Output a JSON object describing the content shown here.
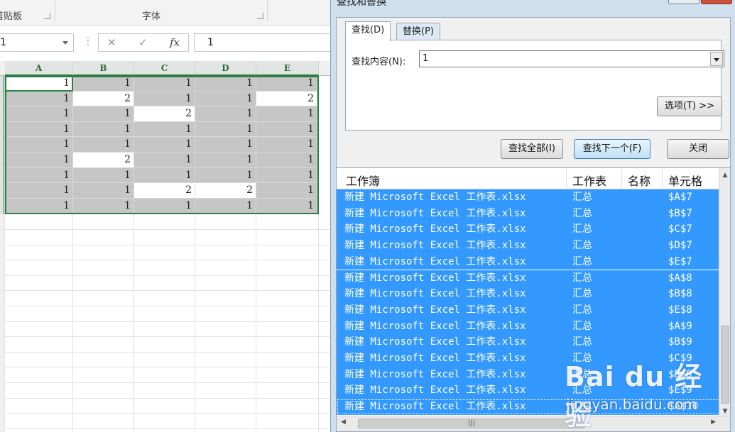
{
  "ribbon": {
    "clipboard_label": "剪贴板",
    "font_label": "字体"
  },
  "formula_bar": {
    "name_box_value": "1",
    "more_icon": "⋮",
    "cancel_icon": "✕",
    "enter_icon": "✓",
    "fx_label": "fx",
    "formula_value": "1"
  },
  "sheet": {
    "columns": [
      "A",
      "B",
      "C",
      "D",
      "E"
    ],
    "rows": [
      [
        1,
        1,
        1,
        1,
        1
      ],
      [
        1,
        2,
        1,
        1,
        2
      ],
      [
        1,
        1,
        2,
        1,
        1
      ],
      [
        1,
        1,
        1,
        1,
        1
      ],
      [
        1,
        1,
        1,
        1,
        1
      ],
      [
        1,
        2,
        1,
        1,
        1
      ],
      [
        1,
        1,
        1,
        1,
        1
      ],
      [
        1,
        1,
        2,
        2,
        1
      ],
      [
        1,
        1,
        1,
        1,
        1
      ]
    ],
    "found": [
      [
        0,
        1,
        1,
        1,
        1
      ],
      [
        1,
        0,
        1,
        1,
        0
      ],
      [
        1,
        1,
        0,
        1,
        1
      ],
      [
        1,
        1,
        1,
        1,
        1
      ],
      [
        1,
        1,
        1,
        1,
        1
      ],
      [
        1,
        0,
        1,
        1,
        1
      ],
      [
        1,
        1,
        1,
        1,
        1
      ],
      [
        1,
        1,
        0,
        0,
        1
      ],
      [
        1,
        1,
        1,
        1,
        1
      ]
    ],
    "highlight_color": "#c6c6c6",
    "selection_color": "#2e7d46"
  },
  "dialog": {
    "title": "查找和替换",
    "tabs": {
      "find": "查找(D)",
      "replace": "替换(P)"
    },
    "find_label": "查找内容(N):",
    "find_value": "1",
    "options_button": "选项(T) >>",
    "find_all_button": "查找全部(I)",
    "find_next_button": "查找下一个(F)",
    "close_button": "关闭",
    "results_headers": {
      "workbook": "工作簿",
      "sheet": "工作表",
      "name": "名称",
      "cell": "单元格"
    },
    "results": [
      {
        "workbook": "新建 Microsoft Excel 工作表.xlsx",
        "sheet": "汇总",
        "cell": "$A$7"
      },
      {
        "workbook": "新建 Microsoft Excel 工作表.xlsx",
        "sheet": "汇总",
        "cell": "$B$7"
      },
      {
        "workbook": "新建 Microsoft Excel 工作表.xlsx",
        "sheet": "汇总",
        "cell": "$C$7"
      },
      {
        "workbook": "新建 Microsoft Excel 工作表.xlsx",
        "sheet": "汇总",
        "cell": "$D$7"
      },
      {
        "workbook": "新建 Microsoft Excel 工作表.xlsx",
        "sheet": "汇总",
        "cell": "$E$7"
      },
      {
        "workbook": "新建 Microsoft Excel 工作表.xlsx",
        "sheet": "汇总",
        "cell": "$A$8"
      },
      {
        "workbook": "新建 Microsoft Excel 工作表.xlsx",
        "sheet": "汇总",
        "cell": "$B$8"
      },
      {
        "workbook": "新建 Microsoft Excel 工作表.xlsx",
        "sheet": "汇总",
        "cell": "$E$8"
      },
      {
        "workbook": "新建 Microsoft Excel 工作表.xlsx",
        "sheet": "汇总",
        "cell": "$A$9"
      },
      {
        "workbook": "新建 Microsoft Excel 工作表.xlsx",
        "sheet": "汇总",
        "cell": "$B$9"
      },
      {
        "workbook": "新建 Microsoft Excel 工作表.xlsx",
        "sheet": "汇总",
        "cell": "$C$9"
      },
      {
        "workbook": "新建 Microsoft Excel 工作表.xlsx",
        "sheet": "汇总",
        "cell": "$D$9"
      },
      {
        "workbook": "新建 Microsoft Excel 工作表.xlsx",
        "sheet": "汇总",
        "cell": "$E$9"
      },
      {
        "workbook": "新建 Microsoft Excel 工作表.xlsx",
        "sheet": "汇总",
        "cell": "$A$10"
      }
    ],
    "selected_row_color": "#3399ff"
  },
  "watermark": {
    "logo_text": "Bai du 经验",
    "url": "jingyan.baidu.com"
  },
  "icons": {
    "launcher": "dialog-launcher-icon",
    "dropdown": "chevron-down-icon"
  }
}
